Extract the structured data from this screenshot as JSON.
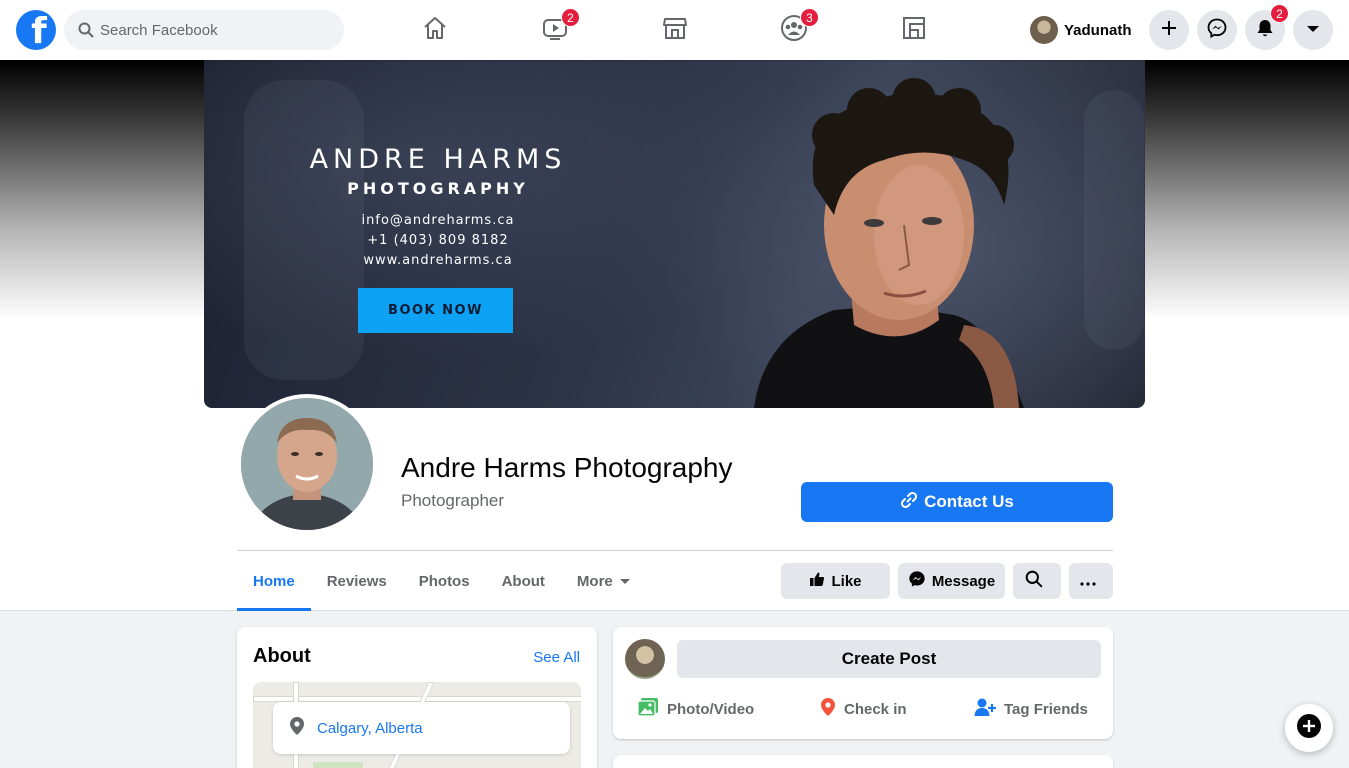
{
  "topnav": {
    "search_placeholder": "Search Facebook",
    "watch_badge": "2",
    "groups_badge": "3",
    "user_name": "Yadunath",
    "notifications_badge": "2",
    "icons": [
      "home-icon",
      "watch-icon",
      "marketplace-icon",
      "groups-icon",
      "gaming-icon",
      "plus-icon",
      "messenger-icon",
      "bell-icon",
      "caret-down-icon"
    ]
  },
  "cover": {
    "title": "ANDRE HARMS",
    "subtitle": "PHOTOGRAPHY",
    "email": "info@andreharms.ca",
    "phone": "+1 (403) 809 8182",
    "website": "www.andreharms.ca",
    "cta": "BOOK NOW"
  },
  "page": {
    "name": "Andre Harms Photography",
    "category": "Photographer",
    "contact_label": "Contact Us"
  },
  "tabs": [
    {
      "label": "Home",
      "active": true
    },
    {
      "label": "Reviews"
    },
    {
      "label": "Photos"
    },
    {
      "label": "About"
    },
    {
      "label": "More"
    }
  ],
  "actions": {
    "like": "Like",
    "message": "Message"
  },
  "about": {
    "title": "About",
    "see_all": "See All",
    "location": "Calgary, Alberta"
  },
  "composer": {
    "create_post": "Create Post",
    "photo_video": "Photo/Video",
    "check_in": "Check in",
    "tag_friends": "Tag Friends"
  },
  "colors": {
    "brand": "#1877f2",
    "badge": "#e41e3f",
    "book_button": "#0ea2f5"
  }
}
